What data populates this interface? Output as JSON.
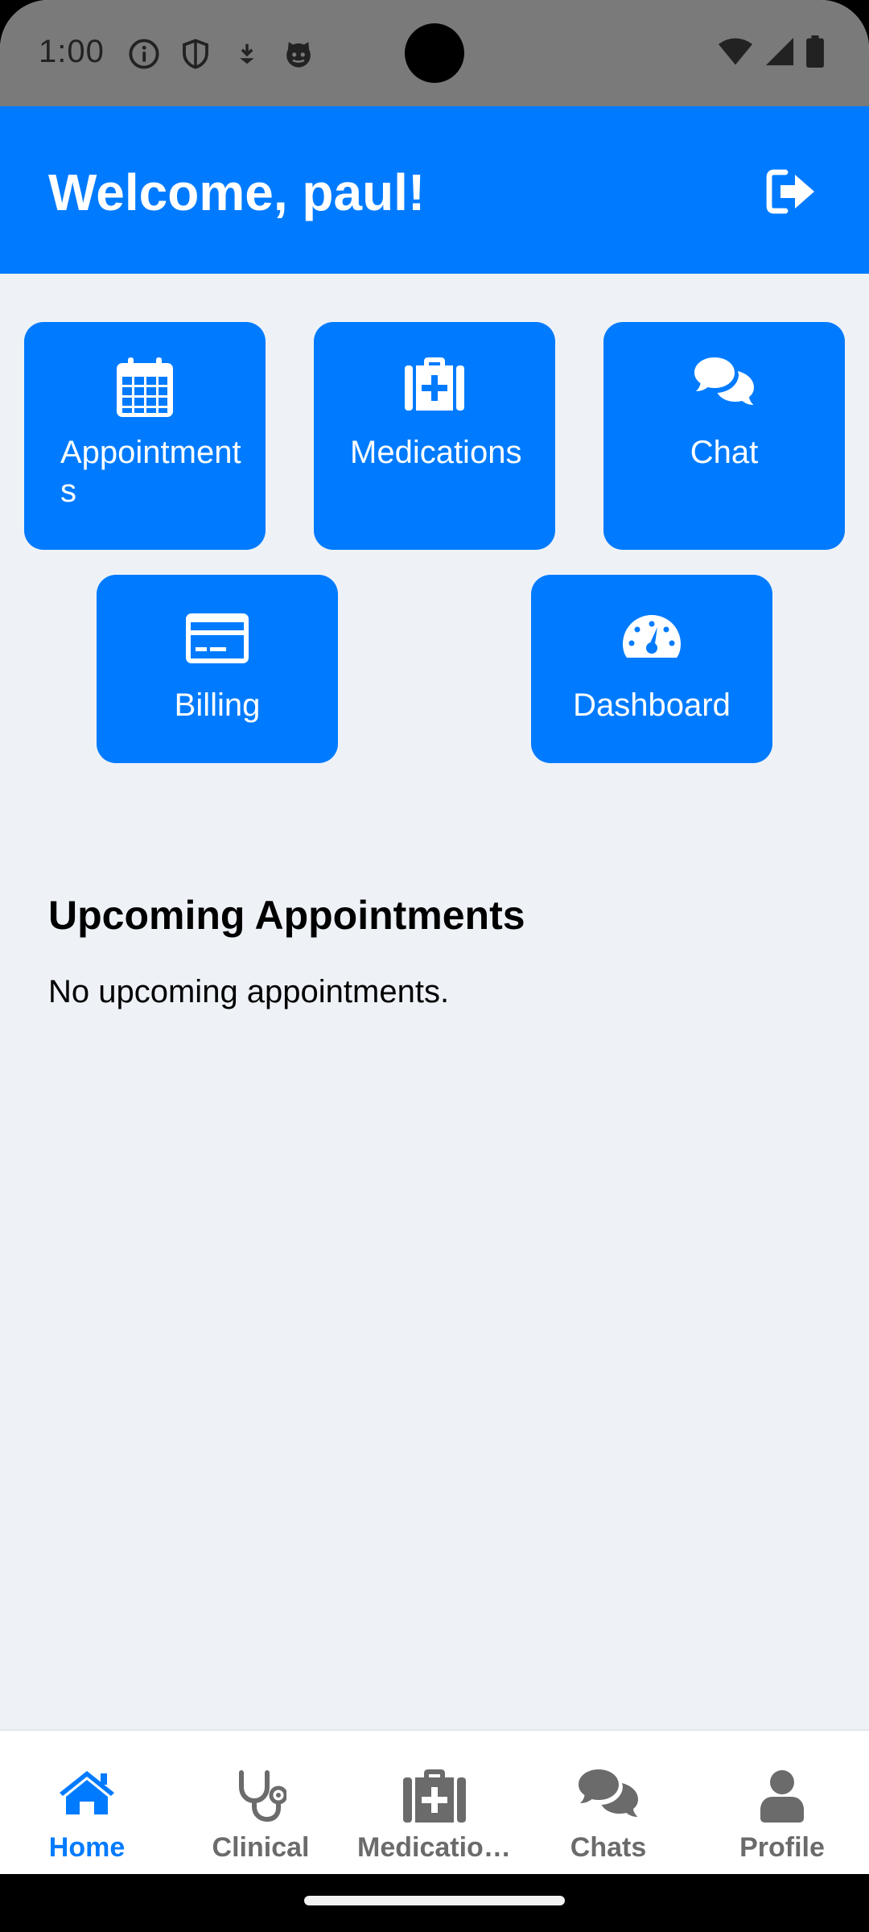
{
  "status_bar": {
    "time": "1:00",
    "left_icons": [
      "info-icon",
      "shield-icon",
      "download-icon",
      "cat-icon"
    ],
    "right_icons": [
      "wifi-icon",
      "signal-icon",
      "battery-icon"
    ]
  },
  "header": {
    "title": "Welcome, paul!",
    "logout_icon": "logout-icon"
  },
  "tiles": [
    {
      "label": "Appointments",
      "icon": "calendar-icon"
    },
    {
      "label": "Medications",
      "icon": "medkit-icon"
    },
    {
      "label": "Chat",
      "icon": "chat-icon"
    },
    {
      "label": "Billing",
      "icon": "credit-card-icon"
    },
    {
      "label": "Dashboard",
      "icon": "gauge-icon"
    }
  ],
  "upcoming": {
    "heading": "Upcoming Appointments",
    "empty_text": "No upcoming appointments."
  },
  "bottom_nav": {
    "items": [
      {
        "label": "Home",
        "icon": "home-icon",
        "active": true
      },
      {
        "label": "Clinical",
        "icon": "stethoscope-icon",
        "active": false
      },
      {
        "label": "Medications",
        "icon": "medkit-icon",
        "active": false
      },
      {
        "label": "Chats",
        "icon": "chat-icon",
        "active": false
      },
      {
        "label": "Profile",
        "icon": "user-icon",
        "active": false
      }
    ]
  },
  "colors": {
    "primary": "#007bff",
    "background": "#eef2f7",
    "status_bar": "#7a7a7a",
    "inactive_nav": "#6b6b6b"
  }
}
